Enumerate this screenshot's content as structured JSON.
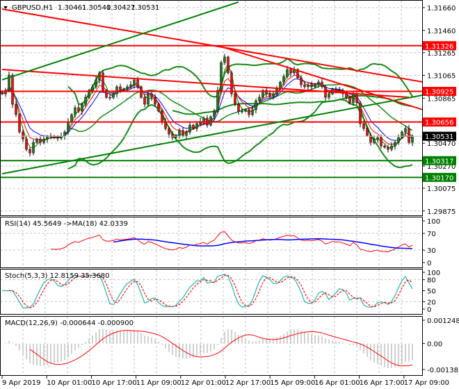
{
  "header": {
    "symbol": "GBPUSD,H1",
    "open": "1.30461",
    "high": "1.30540",
    "low": "1.30427",
    "close": "1.30531"
  },
  "indicators": {
    "rsi_label": "RSI(14) 45.5649  ->MA(18) 42.0339",
    "stoch_label": "Stoch(5,3,3) 12.8159 35.3680",
    "macd_label": "MACD(12,26,9) -0.000644 -0.000900"
  },
  "colors": {
    "bull": "#1e7b1e",
    "bear": "#e81010",
    "support": "#008000",
    "resistance": "#ff0000",
    "rsi": "#ff0000",
    "rsi_ma": "#0000ff",
    "stoch_main": "#20b2aa",
    "stoch_signal": "#ff0000",
    "macd_hist": "#c0c0c0",
    "macd_signal": "#ff0000"
  },
  "chart_data": {
    "type": "candlestick",
    "title": "GBPUSD,H1",
    "ylim": [
      1.29837,
      1.31727
    ],
    "grid": true,
    "price_ticks": [
      "1.31660",
      "1.31460",
      "1.31265",
      "1.31065",
      "1.30865",
      "1.30470",
      "1.30270",
      "1.30075",
      "1.29875"
    ],
    "time_labels": [
      "9 Apr 2019",
      "10 Apr 01:00",
      "10 Apr 17:00",
      "11 Apr 09:00",
      "12 Apr 01:00",
      "12 Apr 17:00",
      "15 Apr 09:00",
      "16 Apr 01:00",
      "16 Apr 17:00",
      "17 Apr 09:00"
    ],
    "closes": [
      1.30904,
      1.30934,
      1.31068,
      1.30812,
      1.30721,
      1.30568,
      1.30507,
      1.30416,
      1.30385,
      1.30477,
      1.30507,
      1.30477,
      1.30507,
      1.30526,
      1.30532,
      1.3052,
      1.30514,
      1.30532,
      1.30568,
      1.3066,
      1.30721,
      1.30782,
      1.30751,
      1.30812,
      1.30873,
      1.30934,
      1.30965,
      1.31026,
      1.31087,
      1.30934,
      1.30873,
      1.30873,
      1.30904,
      1.30965,
      1.30934,
      1.30946,
      1.30965,
      1.30983,
      1.31026,
      1.30965,
      1.30873,
      1.30812,
      1.30904,
      1.30873,
      1.30812,
      1.30751,
      1.3066,
      1.30599,
      1.3055,
      1.3052,
      1.30538,
      1.30581,
      1.30538,
      1.30568,
      1.30629,
      1.30599,
      1.30642,
      1.3066,
      1.3069,
      1.30629,
      1.30703,
      1.30751,
      1.30934,
      1.31178,
      1.31227,
      1.31087,
      1.30904,
      1.30812,
      1.30751,
      1.30751,
      1.30764,
      1.30721,
      1.30764,
      1.30843,
      1.30873,
      1.30934,
      1.30904,
      1.30885,
      1.30904,
      1.30946,
      1.31007,
      1.31056,
      1.31117,
      1.31087,
      1.31117,
      1.31044,
      1.30983,
      1.30965,
      1.30983,
      1.30965,
      1.30983,
      1.31007,
      1.30965,
      1.30873,
      1.30904,
      1.30946,
      1.30934,
      1.30934,
      1.30904,
      1.30873,
      1.30825,
      1.30904,
      1.30825,
      1.30642,
      1.30599,
      1.30538,
      1.30477,
      1.30507,
      1.3052,
      1.30446,
      1.30434,
      1.30416,
      1.30446,
      1.30477,
      1.3052,
      1.30568,
      1.30599,
      1.30477,
      1.30531
    ],
    "levels": [
      {
        "price": "1.31326",
        "color": "#ff0000"
      },
      {
        "price": "1.30925",
        "color": "#ff0000"
      },
      {
        "price": "1.30656",
        "color": "#ff0000"
      },
      {
        "price": "1.30317",
        "color": "#008000"
      },
      {
        "price": "1.30170",
        "color": "#008000"
      }
    ],
    "current_price": "1.30531",
    "trendlines": [
      {
        "color": "#ff0000",
        "from_bar": 0,
        "from_price": 1.31648,
        "to_bar": 121,
        "to_price": 1.31007
      },
      {
        "color": "#ff0000",
        "from_bar": 63,
        "from_price": 1.31318,
        "to_bar": 121,
        "to_price": 1.30764
      },
      {
        "color": "#ff0000",
        "from_bar": 0,
        "from_price": 1.31117,
        "to_bar": 117,
        "to_price": 1.30873
      },
      {
        "color": "#008000",
        "from_bar": 0,
        "from_price": 1.31026,
        "to_bar": 68,
        "to_price": 1.31709
      },
      {
        "color": "#008000",
        "from_bar": 0,
        "from_price": 1.30202,
        "to_bar": 121,
        "to_price": 1.30892
      }
    ],
    "rsi": {
      "ylim": [
        0,
        100
      ],
      "ticks": [
        "100",
        "70",
        "30",
        "0"
      ]
    },
    "stoch": {
      "ylim": [
        0,
        100
      ],
      "ticks": [
        "100",
        "80",
        "50",
        "20",
        "0"
      ]
    },
    "macd": {
      "ylim": [
        -0.001387,
        0.001248
      ],
      "ticks": [
        "0.001248",
        "0.00",
        "-0.001387"
      ]
    }
  }
}
